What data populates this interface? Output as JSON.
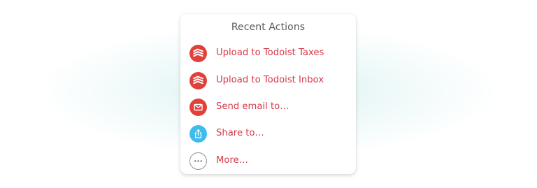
{
  "panel": {
    "title": "Recent Actions",
    "actions": [
      {
        "label": "Upload to Todoist Taxes",
        "icon": "todoist-icon",
        "color": "#e2413a"
      },
      {
        "label": "Upload to Todoist Inbox",
        "icon": "todoist-icon",
        "color": "#e2413a"
      },
      {
        "label": "Send email to…",
        "icon": "mail-icon",
        "color": "#e2413a"
      },
      {
        "label": "Share to…",
        "icon": "share-icon",
        "color": "#3fbcee"
      },
      {
        "label": "More…",
        "icon": "more-icon",
        "color": "#8f9395"
      }
    ]
  },
  "colors": {
    "label_text": "#d53a4a",
    "title_text": "#555a5c",
    "backdrop_glow": "#c4e8e8"
  }
}
